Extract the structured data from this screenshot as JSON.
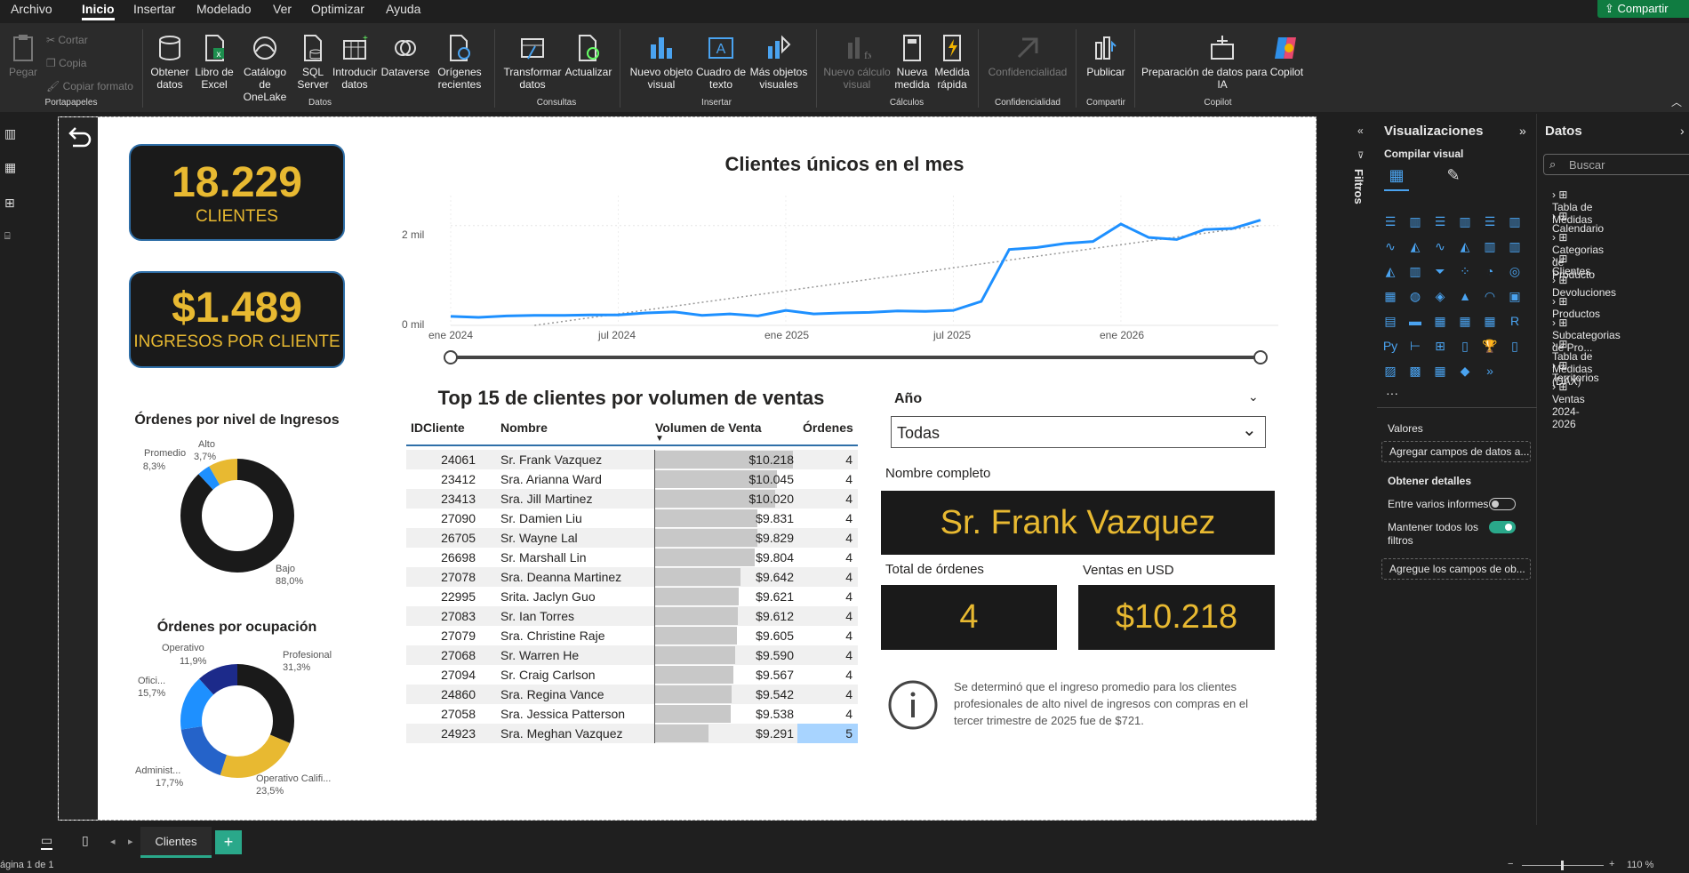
{
  "menu": {
    "items": [
      "Archivo",
      "Inicio",
      "Insertar",
      "Modelado",
      "Ver",
      "Optimizar",
      "Ayuda"
    ],
    "share_label": "Compartir"
  },
  "ribbon": {
    "clipboard": {
      "paste": "Pegar",
      "cut": "Cortar",
      "copy": "Copia",
      "format": "Copiar formato",
      "group": "Portapapeles"
    },
    "data": {
      "get": "Obtener datos",
      "excel": "Libro de Excel",
      "onelake": "Catálogo de OneLake",
      "sql": "SQL Server",
      "enter": "Introducir datos",
      "dataverse": "Dataverse",
      "recent": "Orígenes recientes",
      "group": "Datos"
    },
    "queries": {
      "transform": "Transformar datos",
      "refresh": "Actualizar",
      "group": "Consultas"
    },
    "insert": {
      "new_visual": "Nuevo objeto visual",
      "textbox": "Cuadro de texto",
      "more": "Más objetos visuales",
      "group": "Insertar"
    },
    "calc": {
      "new_calc": "Nuevo cálculo visual",
      "new_measure": "Nueva medida",
      "quick": "Medida rápida",
      "group": "Cálculos"
    },
    "sens": {
      "label": "Confidencialidad",
      "group": "Confidencialidad"
    },
    "share": {
      "publish": "Publicar",
      "group": "Compartir"
    },
    "copilot": {
      "prep": "Preparación de datos para Copilot IA",
      "label": "Copilot",
      "group": "Copilot"
    }
  },
  "kpis": {
    "clients_value": "18.229",
    "clients_label": "CLIENTES",
    "income_value": "$1.489",
    "income_label": "INGRESOS POR CLIENTE"
  },
  "donut1": {
    "title": "Órdenes por nivel de Ingresos",
    "labels": [
      {
        "name": "Promedio",
        "pct": "8,3%"
      },
      {
        "name": "Alto",
        "pct": "3,7%"
      },
      {
        "name": "Bajo",
        "pct": "88,0%"
      }
    ]
  },
  "donut2": {
    "title": "Órdenes por ocupación",
    "labels": [
      {
        "name": "Operativo",
        "pct": "11,9%"
      },
      {
        "name": "Profesional",
        "pct": "31,3%"
      },
      {
        "name": "Ofici...",
        "pct": "15,7%"
      },
      {
        "name": "Administ...",
        "pct": "17,7%"
      },
      {
        "name": "Operativo Califi...",
        "pct": "23,5%"
      }
    ]
  },
  "line": {
    "title": "Clientes únicos en el mes",
    "y_ticks": [
      "2 mil",
      "0 mil"
    ],
    "x_ticks": [
      "ene 2024",
      "jul 2024",
      "ene 2025",
      "jul 2025",
      "ene 2026"
    ]
  },
  "chart_data": {
    "type": "line",
    "title": "Clientes únicos en el mes",
    "x": [
      "2024-01",
      "2024-02",
      "2024-03",
      "2024-04",
      "2024-05",
      "2024-06",
      "2024-07",
      "2024-08",
      "2024-09",
      "2024-10",
      "2024-11",
      "2024-12",
      "2025-01",
      "2025-02",
      "2025-03",
      "2025-04",
      "2025-05",
      "2025-06",
      "2025-07",
      "2025-08",
      "2025-09",
      "2025-10",
      "2025-11",
      "2025-12",
      "2026-01",
      "2026-02",
      "2026-03",
      "2026-04",
      "2026-05",
      "2026-06"
    ],
    "series": [
      {
        "values": [
          180,
          160,
          190,
          200,
          200,
          210,
          210,
          250,
          270,
          200,
          230,
          190,
          300,
          230,
          250,
          260,
          290,
          280,
          300,
          480,
          1520,
          1560,
          1640,
          1680,
          2030,
          1760,
          1720,
          1920,
          1940,
          2110
        ]
      }
    ],
    "ylim": [
      0,
      2600
    ],
    "trendline": true,
    "grid": true
  },
  "table": {
    "title": "Top 15 de clientes por volumen de ventas",
    "headers": [
      "IDCliente",
      "Nombre",
      "Volumen de Venta",
      "Órdenes"
    ],
    "rows": [
      {
        "id": "24061",
        "name": "Sr. Frank Vazquez",
        "vol": "$10.218",
        "v": 10218,
        "ord": "4"
      },
      {
        "id": "23412",
        "name": "Sra. Arianna Ward",
        "vol": "$10.045",
        "v": 10045,
        "ord": "4"
      },
      {
        "id": "23413",
        "name": "Sra. Jill Martinez",
        "vol": "$10.020",
        "v": 10020,
        "ord": "4"
      },
      {
        "id": "27090",
        "name": "Sr. Damien Liu",
        "vol": "$9.831",
        "v": 9831,
        "ord": "4"
      },
      {
        "id": "26705",
        "name": "Sr. Wayne Lal",
        "vol": "$9.829",
        "v": 9829,
        "ord": "4"
      },
      {
        "id": "26698",
        "name": "Sr. Marshall Lin",
        "vol": "$9.804",
        "v": 9804,
        "ord": "4"
      },
      {
        "id": "27078",
        "name": "Sra. Deanna Martinez",
        "vol": "$9.642",
        "v": 9642,
        "ord": "4"
      },
      {
        "id": "22995",
        "name": "Srita. Jaclyn Guo",
        "vol": "$9.621",
        "v": 9621,
        "ord": "4"
      },
      {
        "id": "27083",
        "name": "Sr. Ian Torres",
        "vol": "$9.612",
        "v": 9612,
        "ord": "4"
      },
      {
        "id": "27079",
        "name": "Sra. Christine Raje",
        "vol": "$9.605",
        "v": 9605,
        "ord": "4"
      },
      {
        "id": "27068",
        "name": "Sr. Warren He",
        "vol": "$9.590",
        "v": 9590,
        "ord": "4"
      },
      {
        "id": "27094",
        "name": "Sr. Craig Carlson",
        "vol": "$9.567",
        "v": 9567,
        "ord": "4"
      },
      {
        "id": "24860",
        "name": "Sra. Regina Vance",
        "vol": "$9.542",
        "v": 9542,
        "ord": "4"
      },
      {
        "id": "27058",
        "name": "Sra. Jessica Patterson",
        "vol": "$9.538",
        "v": 9538,
        "ord": "4"
      },
      {
        "id": "24923",
        "name": "Sra. Meghan Vazquez",
        "vol": "$9.291",
        "v": 9291,
        "ord": "5"
      }
    ]
  },
  "slicer": {
    "title": "Año",
    "value": "Todas"
  },
  "detail": {
    "name_label": "Nombre completo",
    "name_value": "Sr. Frank Vazquez",
    "orders_label": "Total de órdenes",
    "orders_value": "4",
    "sales_label": "Ventas en USD",
    "sales_value": "$10.218"
  },
  "note": "Se determinó que el ingreso promedio para los clientes profesionales de alto nivel de ingresos con compras en el tercer trimestre de 2025 fue de $721.",
  "filters_label": "Filtros",
  "viz_pane": {
    "title": "Visualizaciones",
    "build": "Compilar visual",
    "values": "Valores",
    "values_placeholder": "Agregar campos de datos a...",
    "drill": "Obtener detalles",
    "cross": "Entre varios informes",
    "keep": "Mantener todos los filtros",
    "drill_placeholder": "Agregue los campos de ob..."
  },
  "data_pane": {
    "title": "Datos",
    "search_placeholder": "Buscar",
    "tables": [
      "Tabla de Medidas",
      "Calendario",
      "Categorias de Producto",
      "Clientes",
      "Devoluciones",
      "Productos",
      "Subcategorias de Pro...",
      "Tabla de Medidas (DAX)",
      "Territorios",
      "Ventas 2024-2026"
    ]
  },
  "tabs": {
    "active": "Clientes"
  },
  "status": {
    "page": "ágina 1 de 1",
    "zoom": "110 %"
  },
  "colors": {
    "gold": "#e8b931",
    "blue": "#1e90ff",
    "dark": "#1a1a1a"
  }
}
